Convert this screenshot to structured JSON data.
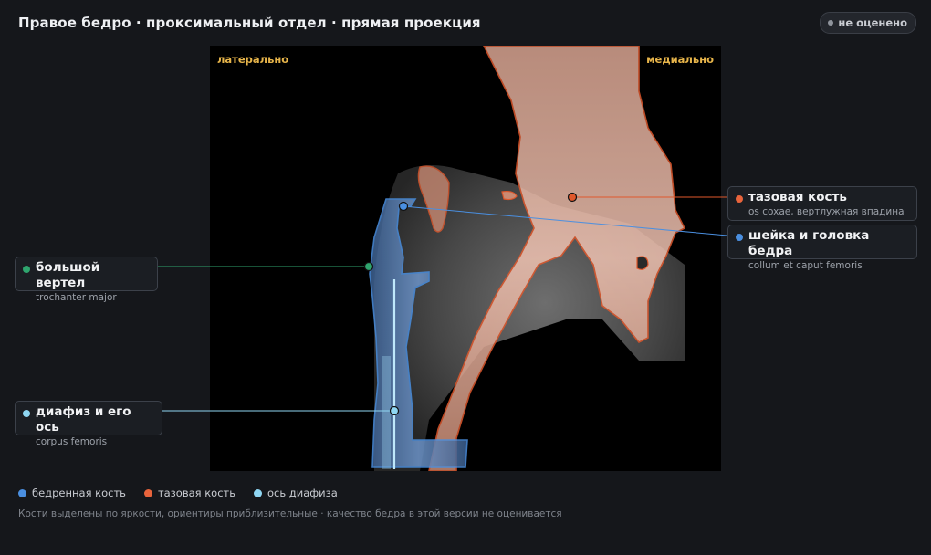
{
  "header": {
    "title": "Правое бедро · проксимальный отдел · прямая проекция",
    "status_badge": "не оценено"
  },
  "viewer": {
    "orientation_left": "латерально",
    "orientation_right": "медиально"
  },
  "callouts": [
    {
      "id": "pelvis",
      "name": "тазовая кость",
      "latin": "os coxae, вертлужная впадина",
      "color": "#e8643c"
    },
    {
      "id": "neck",
      "name": "шейка и головка бедра",
      "latin": "collum et caput femoris",
      "color": "#4a8fe0"
    },
    {
      "id": "trochanter",
      "name": "большой вертел",
      "latin": "trochanter major",
      "color": "#2fa56e"
    },
    {
      "id": "shaft",
      "name": "диафиз и его ось",
      "latin": "corpus femoris",
      "color": "#8fd6f2"
    }
  ],
  "legend": [
    {
      "label": "бедренная кость",
      "color": "#4a8fe0"
    },
    {
      "label": "тазовая кость",
      "color": "#e8643c"
    },
    {
      "label": "ось диафиза",
      "color": "#8fd6f2"
    }
  ],
  "footnote": "Кости выделены по яркости, ориентиры приблизительные · качество бедра в этой версии не оценивается",
  "icons": {
    "status_dot": "status-dot-icon",
    "callout_marker": "circle-marker-icon",
    "legend_swatch": "color-swatch-icon"
  }
}
